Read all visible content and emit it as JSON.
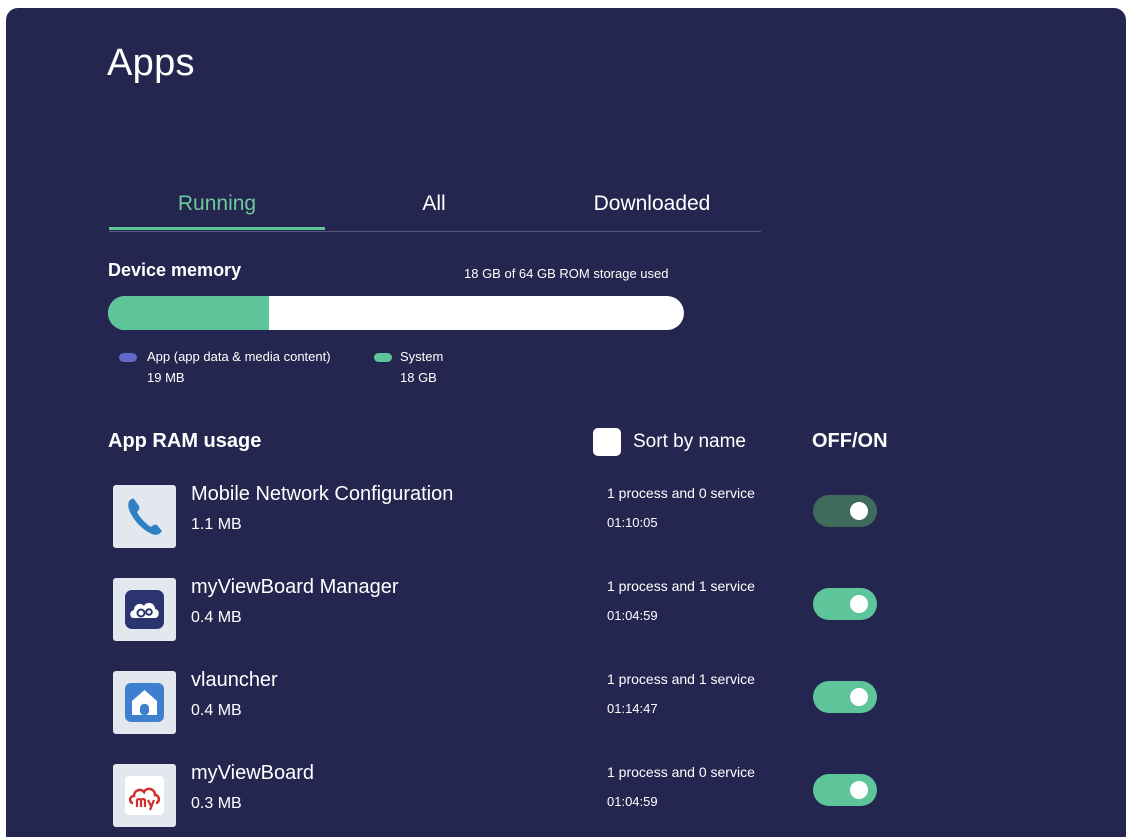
{
  "page": {
    "title": "Apps"
  },
  "tabs": [
    {
      "label": "Running",
      "active": true
    },
    {
      "label": "All",
      "active": false
    },
    {
      "label": "Downloaded",
      "active": false
    }
  ],
  "memory": {
    "title": "Device memory",
    "used_text": "18 GB of 64 GB ROM storage used",
    "used_fraction": 0.28,
    "legend": [
      {
        "label": "App (app data & media content)",
        "value": "19 MB",
        "color": "#6266c8"
      },
      {
        "label": "System",
        "value": "18 GB",
        "color": "#5ec59a"
      }
    ]
  },
  "ram": {
    "title": "App RAM usage",
    "sort_label": "Sort by name",
    "sort_checked": false,
    "offon_label": "OFF/ON"
  },
  "apps": [
    {
      "name": "Mobile Network Configuration",
      "size": "1.1 MB",
      "processes": "1 process and 0 service",
      "time": "01:10:05",
      "icon": "phone-icon",
      "on": true
    },
    {
      "name": "myViewBoard Manager",
      "size": "0.4 MB",
      "processes": "1 process and 1 service",
      "time": "01:04:59",
      "icon": "cloud-gears-icon",
      "on": true
    },
    {
      "name": "vlauncher",
      "size": "0.4 MB",
      "processes": "1 process and 1 service",
      "time": "01:14:47",
      "icon": "home-icon",
      "on": true
    },
    {
      "name": "myViewBoard",
      "size": "0.3 MB",
      "processes": "1 process and 0 service",
      "time": "01:04:59",
      "icon": "myviewboard-logo-icon",
      "on": true
    }
  ],
  "colors": {
    "background": "#24264f",
    "accent": "#5ec59a",
    "accent_dim": "#3e6b5a"
  }
}
